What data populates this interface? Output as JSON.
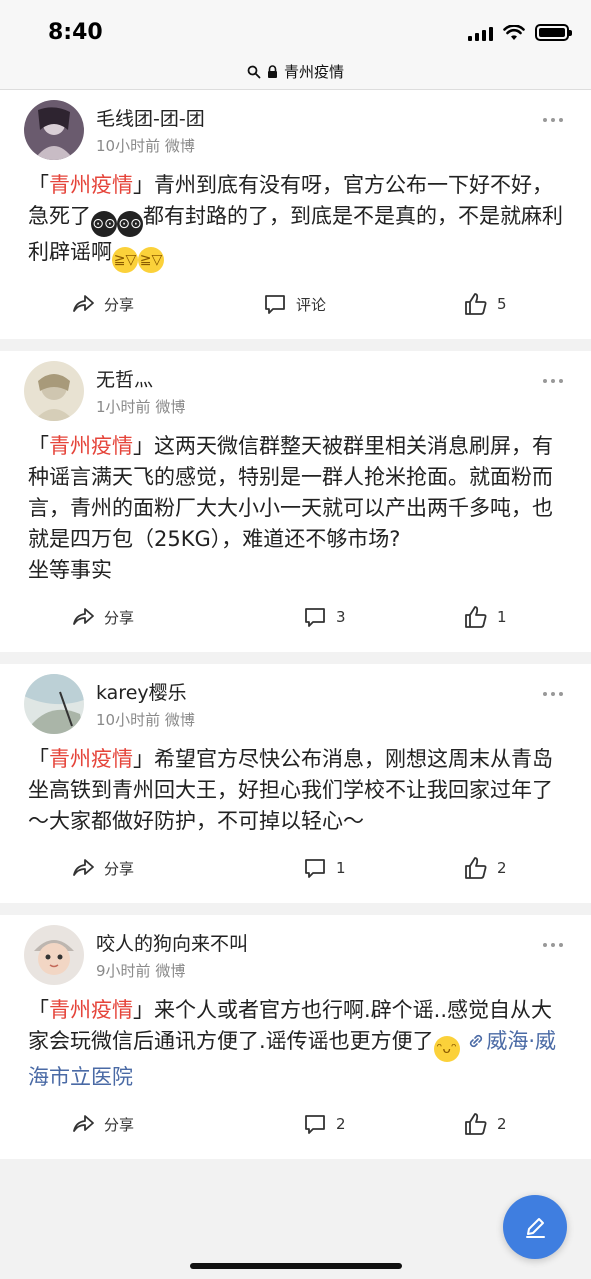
{
  "status_bar": {
    "time": "8:40"
  },
  "url_bar": {
    "title": "青州疫情"
  },
  "posts": [
    {
      "username": "毛线团-团-团",
      "time": "10小时前",
      "source": "微博",
      "tag": "青州疫情",
      "bracket_open": "「",
      "bracket_close": "」",
      "text_before_emoji": "青州到底有没有呀，官方公布一下好不好，急死了",
      "text_middle": "都有封路的了，到底是不是真的，不是就麻利利辟谣啊",
      "share_label": "分享",
      "comment_label": "评论",
      "like_count": "5"
    },
    {
      "username": "无哲灬",
      "time": "1小时前",
      "source": "微博",
      "tag": "青州疫情",
      "bracket_open": "「",
      "bracket_close": "」",
      "text": "这两天微信群整天被群里相关消息刷屏，有种谣言满天飞的感觉，特别是一群人抢米抢面。就面粉而言，青州的面粉厂大大小小一天就可以产出两千多吨，也就是四万包（25KG），难道还不够市场?",
      "text_line2": "坐等事实",
      "share_label": "分享",
      "comment_count": "3",
      "like_count": "1"
    },
    {
      "username": "karey樱乐",
      "time": "10小时前",
      "source": "微博",
      "tag": "青州疫情",
      "bracket_open": "「",
      "bracket_close": "」",
      "text": "希望官方尽快公布消息，刚想这周末从青岛坐高铁到青州回大王，好担心我们学校不让我回家过年了～大家都做好防护，不可掉以轻心～",
      "share_label": "分享",
      "comment_count": "1",
      "like_count": "2"
    },
    {
      "username": "咬人的狗向来不叫",
      "time": "9小时前",
      "source": "微博",
      "tag": "青州疫情",
      "bracket_open": "「",
      "bracket_close": "」",
      "text": "来个人或者官方也行啊.辟个谣..感觉自从大家会玩微信后通讯方便了.谣传谣也更方便了",
      "location": "威海·威海市立医院",
      "share_label": "分享",
      "comment_count": "2",
      "like_count": "2"
    }
  ],
  "colors": {
    "tag": "#e5443a",
    "location": "#4a6aa5",
    "fab": "#3f7ee0"
  },
  "icons": [
    "search-icon",
    "lock-icon",
    "share-icon",
    "comment-icon",
    "like-icon",
    "more-icon",
    "edit-icon"
  ]
}
